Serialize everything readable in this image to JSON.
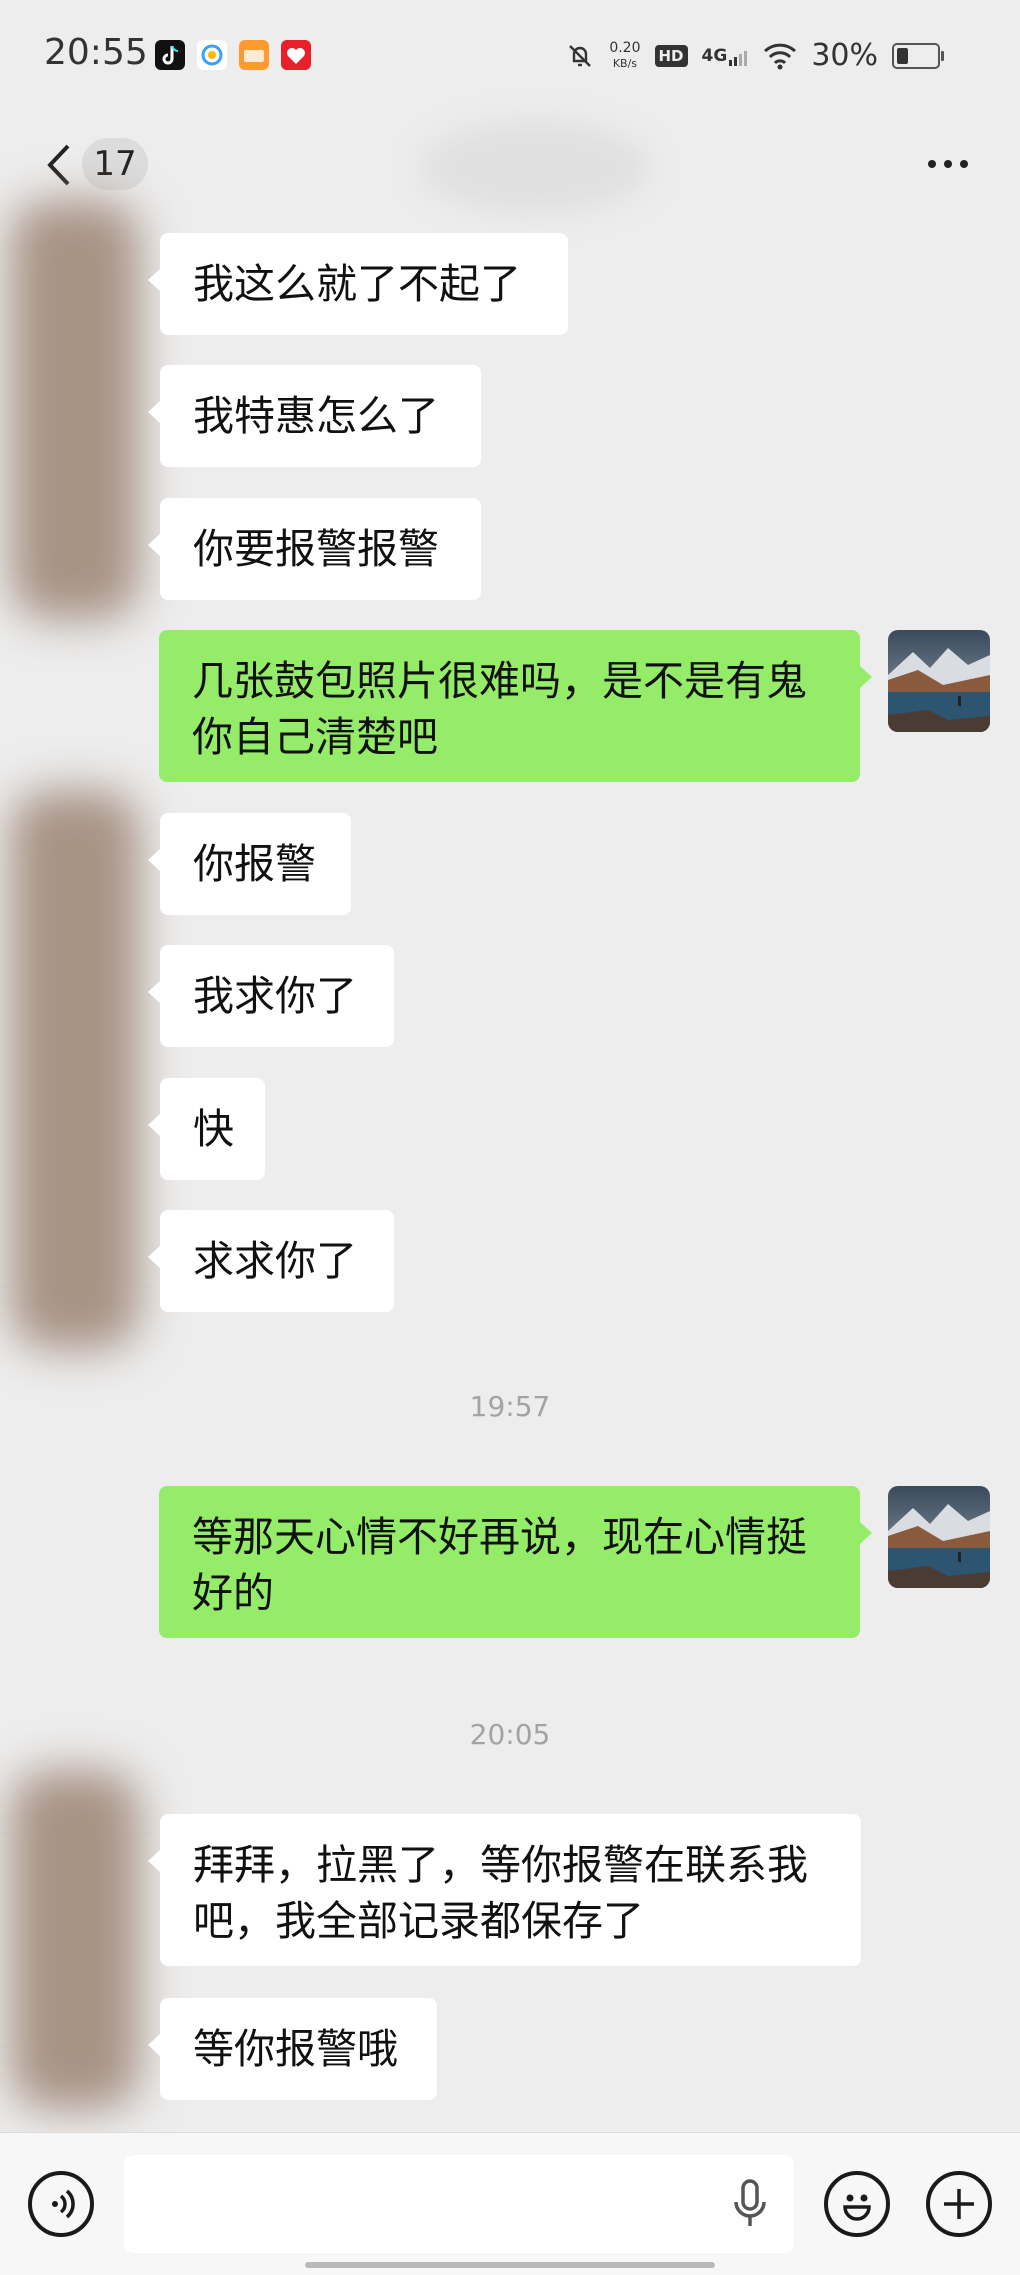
{
  "status_bar": {
    "time": "20:55",
    "network_speed_value": "0.20",
    "network_speed_unit": "KB/s",
    "hd_label": "HD",
    "network_type": "4G",
    "battery_percent": "30%",
    "battery_level": 0.3,
    "app_icons": [
      "douyin-icon",
      "browser-icon",
      "shop-icon",
      "red-app-icon"
    ]
  },
  "header": {
    "unread_count": "17"
  },
  "messages": [
    {
      "from": "them",
      "text": "我这么就了不起了"
    },
    {
      "from": "them",
      "text": "我特惠怎么了"
    },
    {
      "from": "them",
      "text": "你要报警报警"
    },
    {
      "from": "me",
      "text": "几张鼓包照片很难吗，是不是有鬼\n你自己清楚吧"
    },
    {
      "from": "them",
      "text": "你报警"
    },
    {
      "from": "them",
      "text": "我求你了"
    },
    {
      "from": "them",
      "text": "快"
    },
    {
      "from": "them",
      "text": "求求你了"
    },
    {
      "type": "time",
      "text": "19:57"
    },
    {
      "from": "me",
      "text": "等那天心情不好再说，现在心情挺\n好的"
    },
    {
      "type": "time",
      "text": "20:05"
    },
    {
      "from": "them",
      "text": "拜拜，拉黑了，等你报警在联系我\n吧，我全部记录都保存了"
    },
    {
      "from": "them",
      "text": "等你报警哦"
    }
  ],
  "input_bar": {
    "voice_icon": "voice-mode-icon",
    "mic_icon": "microphone-icon",
    "emoji_icon": "emoji-icon",
    "plus_icon": "plus-icon",
    "message_value": ""
  },
  "colors": {
    "background": "#ededed",
    "incoming_bubble": "#ffffff",
    "outgoing_bubble": "#95ec69"
  }
}
